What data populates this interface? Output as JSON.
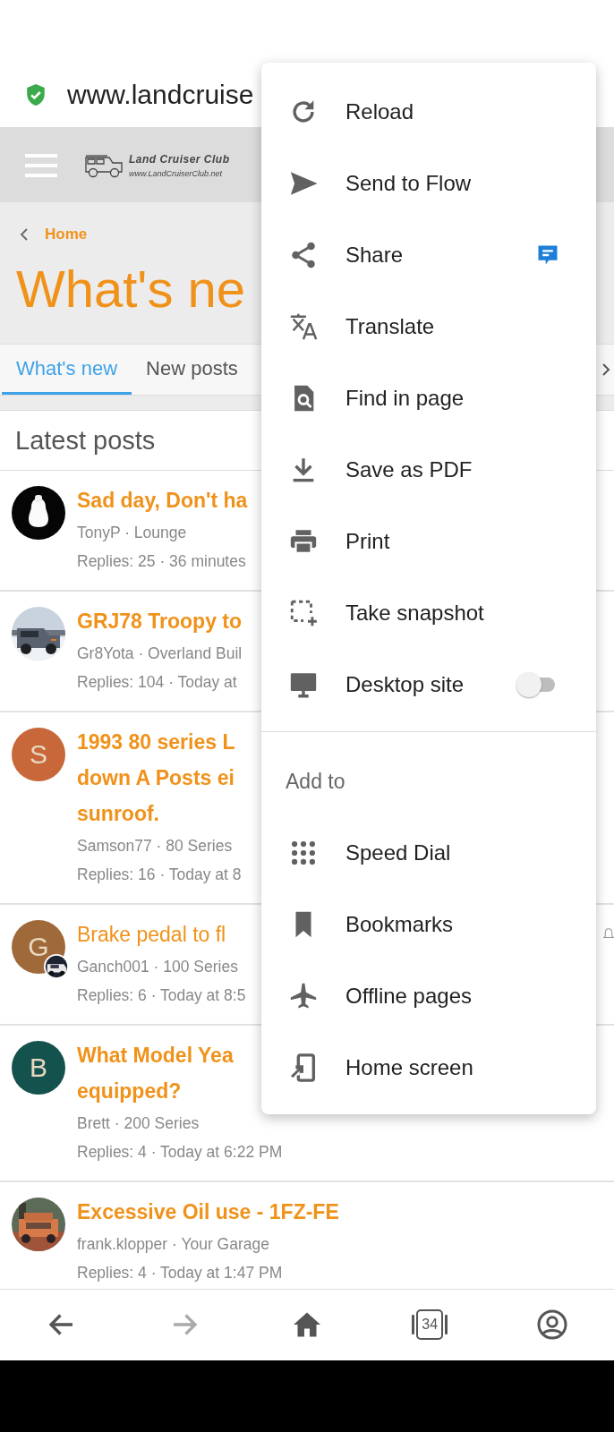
{
  "address_bar": {
    "url": "www.landcruise",
    "secure": true
  },
  "site_header": {
    "logo_title": "Land Cruiser Club",
    "logo_url": "www.LandCruiserClub.net"
  },
  "breadcrumb": "Home",
  "page_title": "What's ne",
  "tabs": [
    {
      "label": "What's new",
      "selected": true
    },
    {
      "label": "New posts",
      "selected": false
    }
  ],
  "section_title": "Latest posts",
  "posts": [
    {
      "avatar": {
        "kind": "picture"
      },
      "title_lines": [
        "Sad day, Don't ha"
      ],
      "unread": true,
      "meta": "TonyP · Lounge",
      "stats": "Replies: 25 · 36 minutes"
    },
    {
      "avatar": {
        "kind": "picture"
      },
      "title_lines": [
        "GRJ78 Troopy to"
      ],
      "unread": true,
      "meta": "Gr8Yota · Overland Buil",
      "stats": "Replies: 104 · Today at"
    },
    {
      "avatar": {
        "kind": "letter",
        "letter": "S",
        "color": "#c8673a"
      },
      "title_lines": [
        "1993 80 series L",
        "down A Posts ei",
        "sunroof."
      ],
      "unread": true,
      "meta": "Samson77 · 80 Series",
      "stats": "Replies: 16 · Today at 8"
    },
    {
      "avatar": {
        "kind": "letter",
        "letter": "G",
        "color": "#a0693a",
        "badge": true
      },
      "title_lines": [
        "Brake pedal to fl"
      ],
      "unread": false,
      "meta": "Ganch001 · 100 Series",
      "stats": "Replies: 6 · Today at 8:5"
    },
    {
      "avatar": {
        "kind": "letter",
        "letter": "B",
        "color": "#14524e"
      },
      "title_lines": [
        "What Model Yea",
        "equipped?"
      ],
      "unread": true,
      "meta": "Brett · 200 Series",
      "stats": "Replies: 4 · Today at 6:22 PM"
    },
    {
      "avatar": {
        "kind": "picture"
      },
      "title_lines": [
        "Excessive Oil use - 1FZ-FE"
      ],
      "unread": true,
      "meta": "frank.klopper · Your Garage",
      "stats": "Replies: 4 · Today at 1:47 PM"
    }
  ],
  "menu": {
    "items": [
      {
        "kind": "action",
        "label": "Reload"
      },
      {
        "kind": "action",
        "label": "Send to Flow"
      },
      {
        "kind": "action",
        "label": "Share"
      },
      {
        "kind": "action",
        "label": "Translate"
      },
      {
        "kind": "action",
        "label": "Find in page"
      },
      {
        "kind": "action",
        "label": "Save as PDF"
      },
      {
        "kind": "action",
        "label": "Print"
      },
      {
        "kind": "action",
        "label": "Take snapshot"
      },
      {
        "kind": "toggle",
        "label": "Desktop site",
        "on": false
      }
    ],
    "section_title": "Add to",
    "add_items": [
      {
        "label": "Speed Dial"
      },
      {
        "label": "Bookmarks"
      },
      {
        "label": "Offline pages"
      },
      {
        "label": "Home screen"
      }
    ]
  },
  "bottom_nav": [
    {
      "kind": "back",
      "disabled": false
    },
    {
      "kind": "forward",
      "disabled": true
    },
    {
      "kind": "home",
      "disabled": false
    },
    {
      "kind": "tabs",
      "count": "34",
      "disabled": false
    },
    {
      "kind": "account",
      "disabled": false
    }
  ]
}
